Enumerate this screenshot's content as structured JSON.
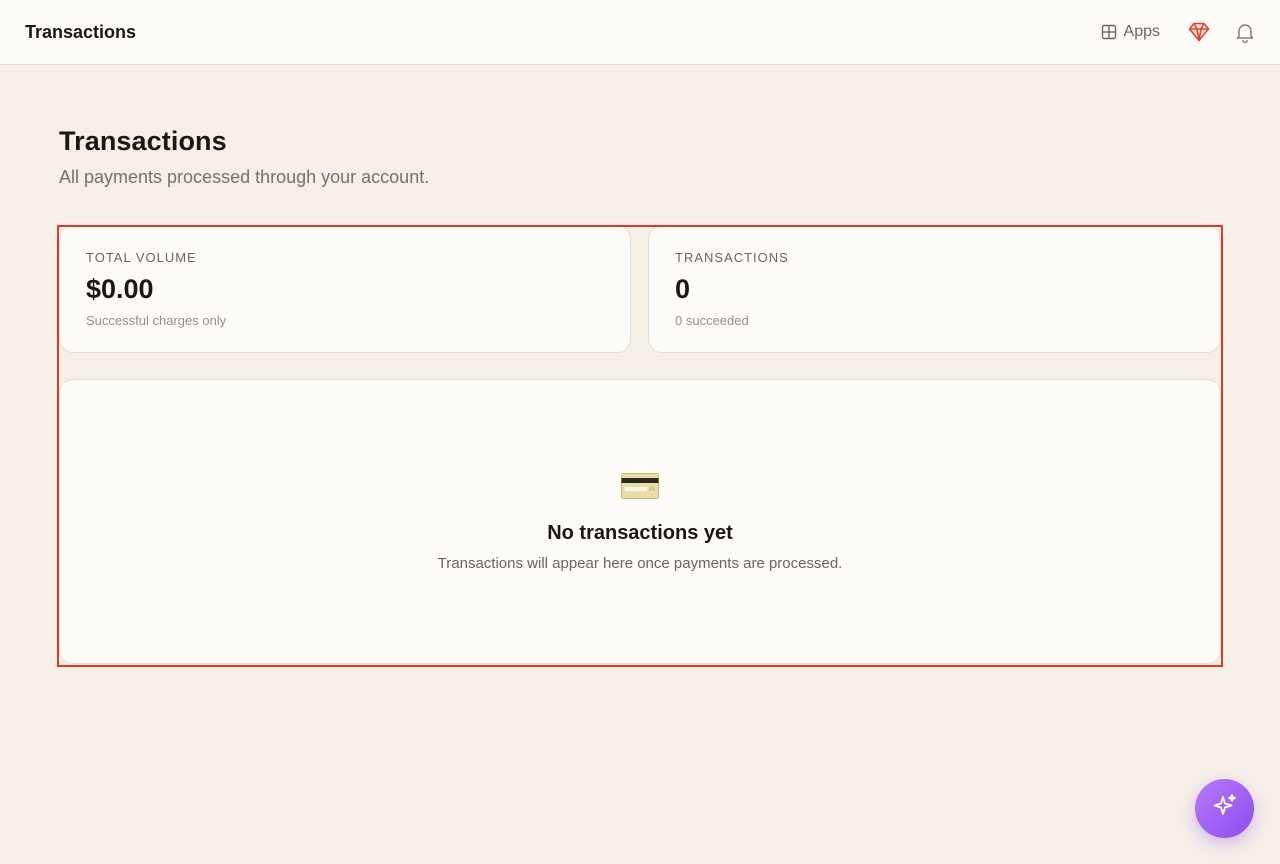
{
  "topbar": {
    "title": "Transactions",
    "apps_label": "Apps",
    "icons": {
      "apps": "grid-icon",
      "gem": "gem-icon",
      "notifications": "bell-icon"
    },
    "gem_color": "#e0462e"
  },
  "header": {
    "title": "Transactions",
    "subtitle": "All payments processed through your account."
  },
  "stats": [
    {
      "label": "TOTAL VOLUME",
      "value": "$0.00",
      "note": "Successful charges only"
    },
    {
      "label": "TRANSACTIONS",
      "value": "0",
      "note": "0 succeeded"
    }
  ],
  "empty_state": {
    "icon": "credit-card-icon",
    "title": "No transactions yet",
    "message": "Transactions will appear here once payments are processed."
  },
  "fab": {
    "icon": "sparkles-icon",
    "color": "#9b5cf6"
  },
  "colors": {
    "background": "#f6efe7",
    "card": "#fdfbf7",
    "highlight": "#e03a26"
  }
}
